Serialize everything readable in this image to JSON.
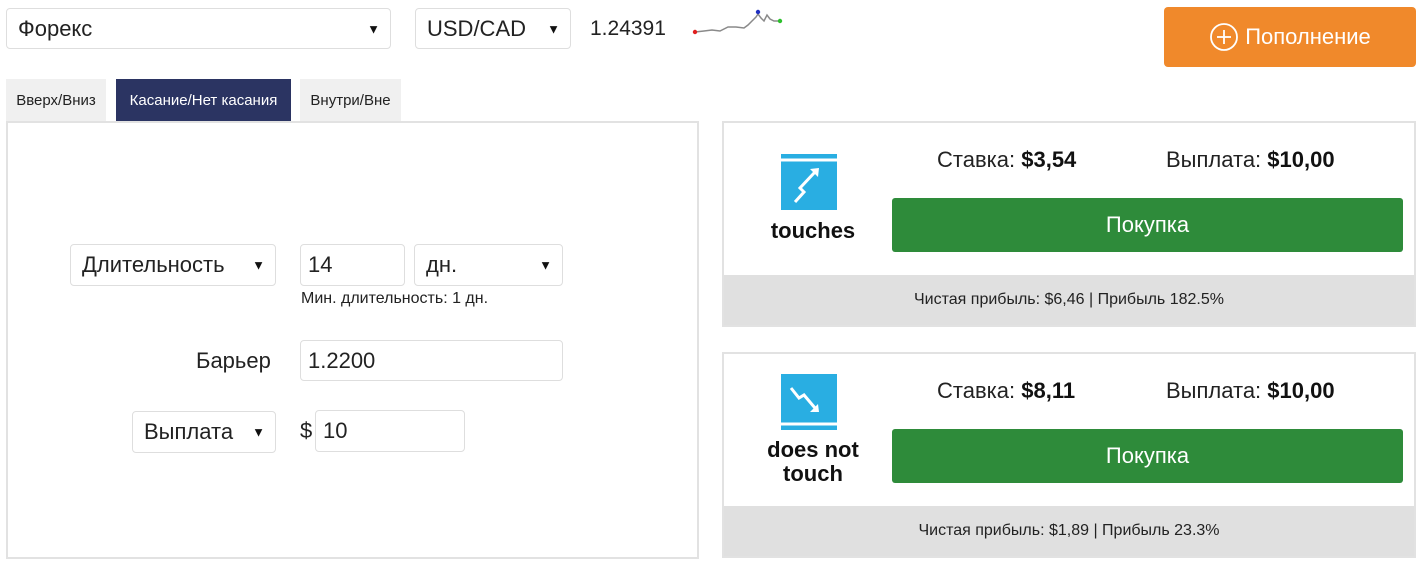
{
  "header": {
    "market": "Форекс",
    "pair": "USD/CAD",
    "price": "1.24391",
    "deposit_label": "Пополнение"
  },
  "tabs": [
    {
      "label": "Вверх/Вниз",
      "active": false
    },
    {
      "label": "Касание/Нет касания",
      "active": true
    },
    {
      "label": "Внутри/Вне",
      "active": false
    }
  ],
  "form": {
    "duration_type": "Длительность",
    "duration_value": "14",
    "duration_unit": "дн.",
    "min_duration": "Мин. длительность: 1 дн.",
    "barrier_label": "Барьер",
    "barrier_value": "1.2200",
    "amount_type": "Выплата",
    "currency": "$",
    "amount_value": "10"
  },
  "contracts": [
    {
      "name": "touches",
      "icon": "trend-up-touch-icon",
      "stake_label": "Ставка:",
      "stake_value": "$3,54",
      "payout_label": "Выплата:",
      "payout_value": "$10,00",
      "buy_label": "Покупка",
      "profit_text": "Чистая прибыль: $6,46 | Прибыль 182.5%"
    },
    {
      "name": "does not touch",
      "icon": "trend-down-no-touch-icon",
      "stake_label": "Ставка:",
      "stake_value": "$8,11",
      "payout_label": "Выплата:",
      "payout_value": "$10,00",
      "buy_label": "Покупка",
      "profit_text": "Чистая прибыль: $1,89 | Прибыль 23.3%"
    }
  ],
  "colors": {
    "accent_orange": "#f0892b",
    "tab_active": "#2b3462",
    "buy_green": "#2e8b3a",
    "icon_blue": "#29aee2",
    "profit_bar": "#e0e0e0"
  }
}
